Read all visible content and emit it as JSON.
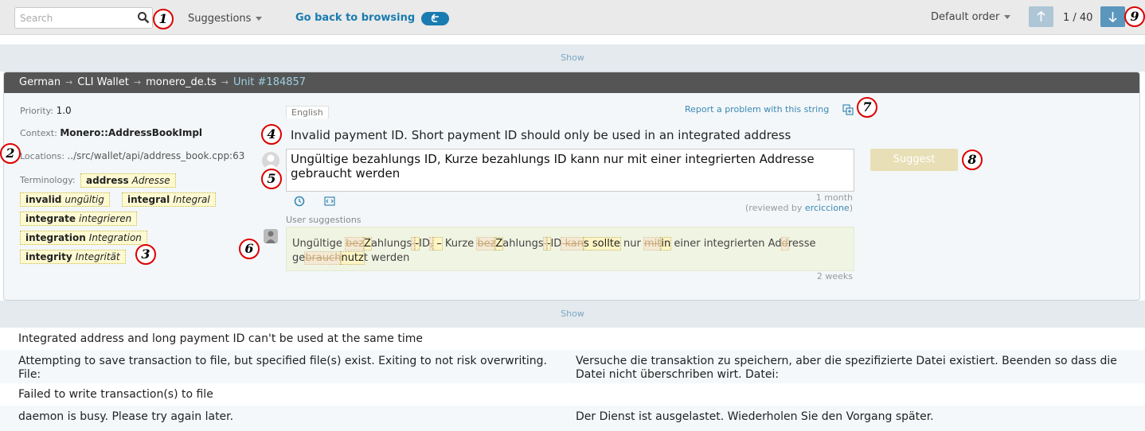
{
  "topbar": {
    "search_placeholder": "Search",
    "suggestions_label": "Suggestions",
    "back_label": "Go back to browsing",
    "order_label": "Default order",
    "counter": "1 / 40"
  },
  "callouts": [
    "1",
    "2",
    "3",
    "4",
    "5",
    "6",
    "7",
    "8",
    "9"
  ],
  "show_label": "Show",
  "breadcrumb": {
    "language": "German",
    "project": "CLI Wallet",
    "file": "monero_de.ts",
    "unit": "Unit #184857",
    "separator": "→"
  },
  "meta": {
    "priority_label": "Priority:",
    "priority_value": "1.0",
    "context_label": "Context:",
    "context_value": "Monero::AddressBookImpl",
    "locations_label": "Locations:",
    "locations_value": "../src/wallet/api/address_book.cpp:63",
    "terminology_label": "Terminology:"
  },
  "terminology": [
    {
      "term": "address",
      "translation": "Adresse"
    },
    {
      "term": "invalid",
      "translation": "ungültig"
    },
    {
      "term": "integral",
      "translation": "Integral"
    },
    {
      "term": "integrate",
      "translation": "integrieren"
    },
    {
      "term": "integration",
      "translation": "Integration"
    },
    {
      "term": "integrity",
      "translation": "Integrität"
    }
  ],
  "unit": {
    "source_lang": "English",
    "report_label": "Report a problem with this string",
    "source_text": "Invalid payment ID. Short payment ID should only be used in an integrated address",
    "translation_text": "Ungültige bezahlungs ID, Kurze bezahlungs ID kann nur mit einer integrierten Addresse gebraucht werden",
    "suggest_label": "Suggest",
    "age": "1 month",
    "reviewed_prefix": "(reviewed by",
    "reviewer": "erciccione",
    "reviewed_suffix": ")",
    "user_suggestions_label": "User suggestions",
    "suggestion_age": "2 weeks",
    "suggestion_parts": [
      {
        "t": "Ungültige ",
        "k": "n"
      },
      {
        "t": "bez",
        "k": "d"
      },
      {
        "t": "Z",
        "k": "i"
      },
      {
        "t": "ahlungs",
        "k": "n"
      },
      {
        "t": " ",
        "k": "d"
      },
      {
        "t": "-",
        "k": "i"
      },
      {
        "t": "ID",
        "k": "n"
      },
      {
        "t": ",",
        "k": "d"
      },
      {
        "t": " –",
        "k": "i"
      },
      {
        "t": " Kurze ",
        "k": "n"
      },
      {
        "t": "bez",
        "k": "d"
      },
      {
        "t": "Z",
        "k": "i"
      },
      {
        "t": "ahlungs",
        "k": "n"
      },
      {
        "t": " ",
        "k": "d"
      },
      {
        "t": "-",
        "k": "i"
      },
      {
        "t": "ID",
        "k": "n"
      },
      {
        "t": " kan",
        "k": "d"
      },
      {
        "t": "s sollte",
        "k": "i"
      },
      {
        "t": " nur ",
        "k": "n"
      },
      {
        "t": "mit",
        "k": "d"
      },
      {
        "t": "in",
        "k": "i"
      },
      {
        "t": " einer integrierten Ad",
        "k": "n"
      },
      {
        "t": "d",
        "k": "d"
      },
      {
        "t": "resse ge",
        "k": "n"
      },
      {
        "t": "brauch",
        "k": "d"
      },
      {
        "t": "nutz",
        "k": "i"
      },
      {
        "t": "t werden",
        "k": "n"
      }
    ]
  },
  "list": [
    {
      "source": "Integrated address and long payment ID can't be used at the same time",
      "target": ""
    },
    {
      "source": "Attempting to save transaction to file, but specified file(s) exist. Exiting to not risk overwriting. File:",
      "target": "Versuche die transaktion zu speichern, aber die spezifizierte Datei existiert. Beenden so dass die Datei nicht überschriben wirt. Datei:"
    },
    {
      "source": "Failed to write transaction(s) to file",
      "target": ""
    },
    {
      "source": "daemon is busy. Please try again later.",
      "target": "Der Dienst ist ausgelastet. Wiederholen Sie den Vorgang später."
    }
  ]
}
